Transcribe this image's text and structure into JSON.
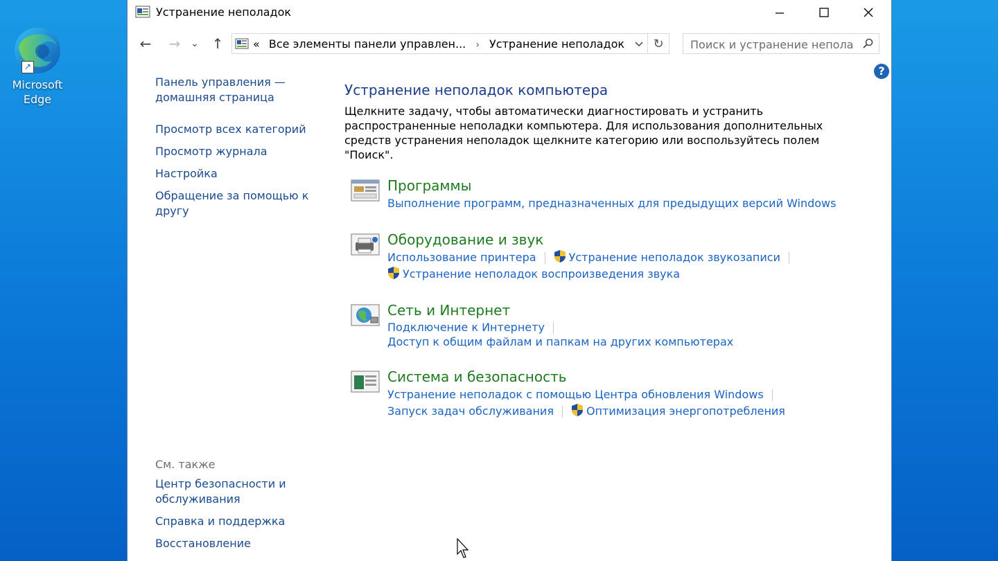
{
  "desktop": {
    "icons": [
      {
        "label": "Microsoft Edge"
      }
    ]
  },
  "window": {
    "title": "Устранение неполадок",
    "controls": {
      "minimize": "—",
      "maximize": "☐",
      "close": "✕"
    }
  },
  "nav": {
    "back": "←",
    "forward": "→",
    "recent": "⌄",
    "up": "↑",
    "breadcrumb": {
      "prefix": "«",
      "items": [
        "Все элементы панели управлен...",
        "Устранение неполадок"
      ],
      "separator": "›"
    },
    "refresh": "↻",
    "search_placeholder": "Поиск и устранение неполад..."
  },
  "help_label": "?",
  "sidebar": {
    "home": "Панель управления — домашняя страница",
    "items": [
      "Просмотр всех категорий",
      "Просмотр журнала",
      "Настройка",
      "Обращение за помощью к другу"
    ],
    "see_also": {
      "header": "См. также",
      "items": [
        "Центр безопасности и обслуживания",
        "Справка и поддержка",
        "Восстановление"
      ]
    }
  },
  "main": {
    "heading": "Устранение неполадок компьютера",
    "description": "Щелкните задачу, чтобы автоматически диагностировать и устранить распространенные неполадки компьютера. Для использования дополнительных средств устранения неполадок щелкните категорию или воспользуйтесь полем \"Поиск\".",
    "categories": [
      {
        "title": "Программы",
        "icon": "programs-icon",
        "links": [
          "Выполнение программ, предназначенных для предыдущих версий Windows"
        ]
      },
      {
        "title": "Оборудование и звук",
        "icon": "hardware-sound-icon",
        "links": [
          "Использование принтера",
          "Устранение неполадок звукозаписи",
          "Устранение неполадок воспроизведения звука"
        ]
      },
      {
        "title": "Сеть и Интернет",
        "icon": "network-icon",
        "links": [
          "Подключение к Интернету",
          "Доступ к общим файлам и папкам на других компьютерах"
        ]
      },
      {
        "title": "Система и безопасность",
        "icon": "system-security-icon",
        "links": [
          "Устранение неполадок с помощью Центра обновления Windows",
          "Запуск задач обслуживания",
          "Оптимизация энергопотребления"
        ]
      }
    ]
  }
}
